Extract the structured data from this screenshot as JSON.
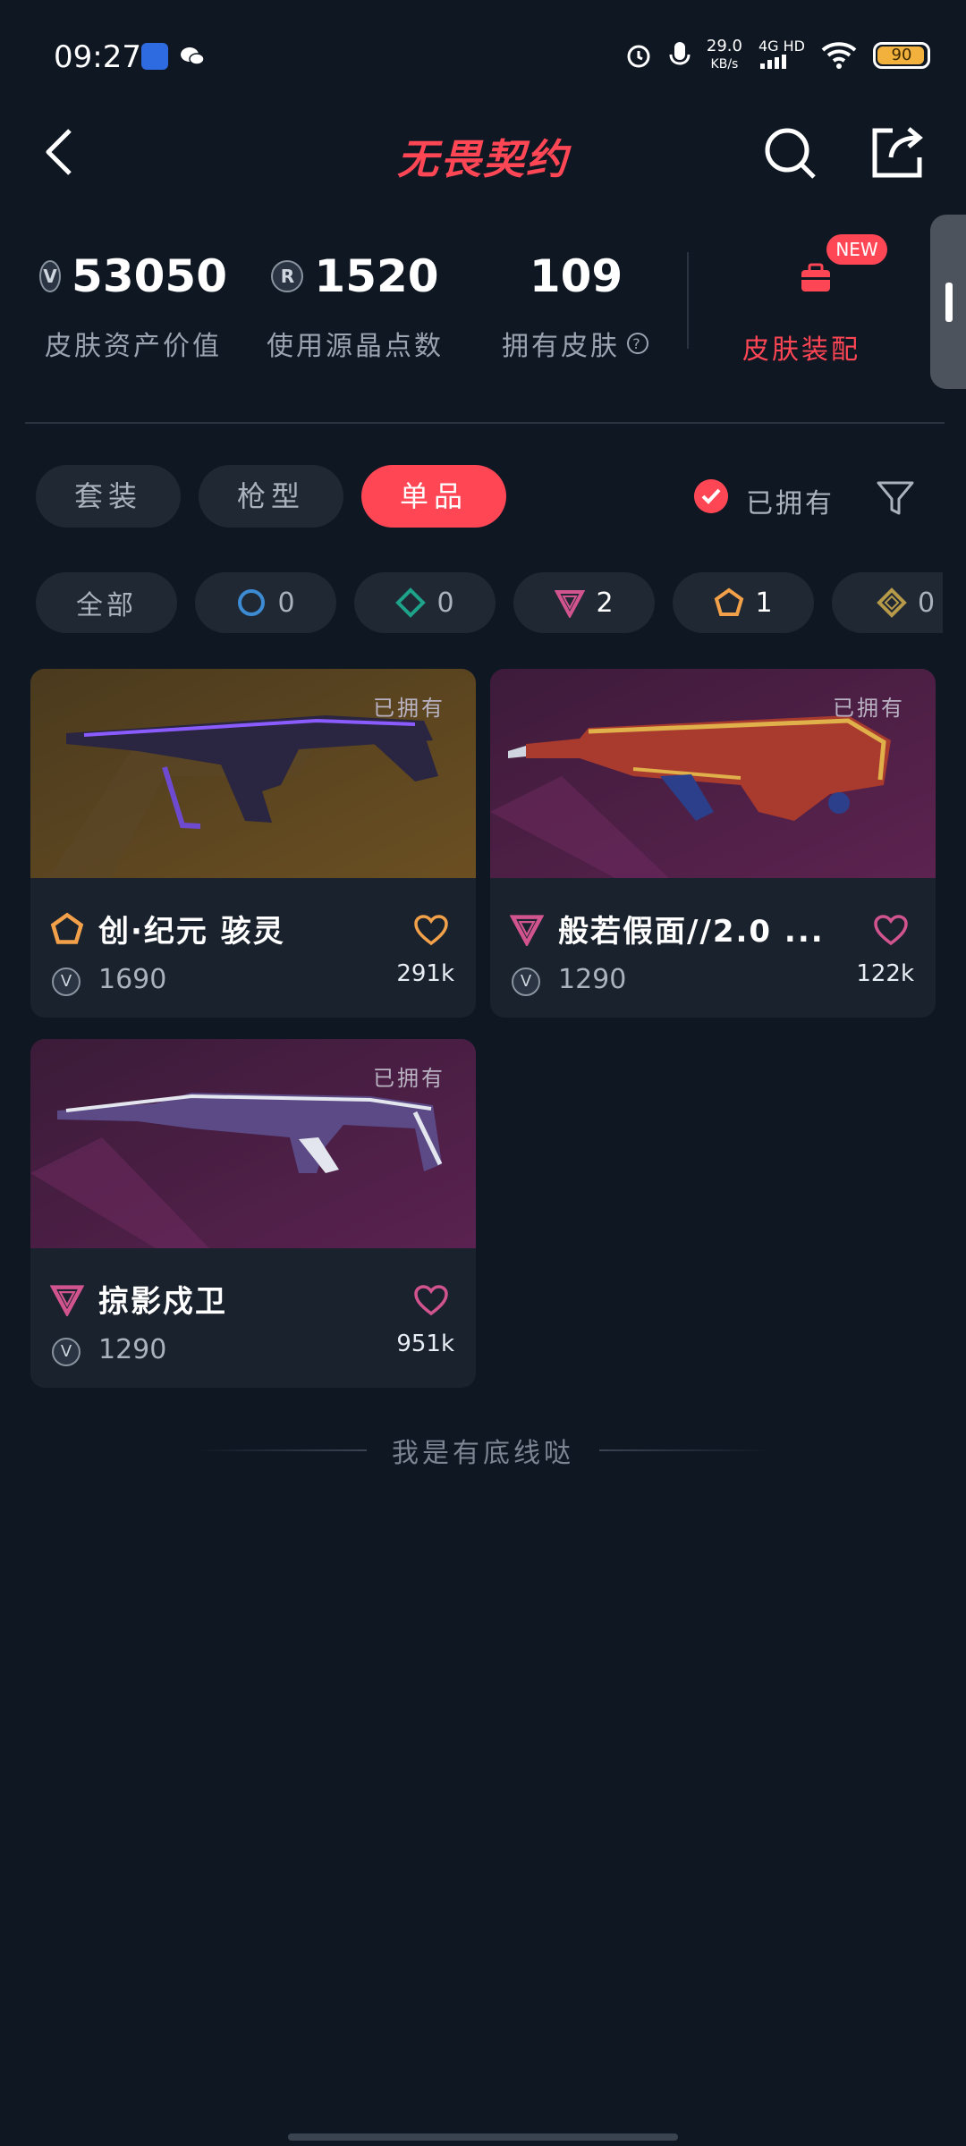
{
  "status_bar": {
    "time": "09:27",
    "net_speed": "29.0",
    "net_unit": "KB/s",
    "net_type": "4G HD",
    "battery": "90"
  },
  "header": {
    "title": "无畏契约"
  },
  "stats": {
    "asset_value": "53050",
    "asset_value_label": "皮肤资产价值",
    "radianite_points": "1520",
    "radianite_points_label": "使用源晶点数",
    "owned_skins": "109",
    "owned_skins_label": "拥有皮肤",
    "new_badge": "NEW",
    "assemble_label": "皮肤装配"
  },
  "tabs": [
    {
      "label": "套装"
    },
    {
      "label": "枪型"
    },
    {
      "label": "单品"
    }
  ],
  "owned_filter": {
    "label": "已拥有",
    "checked": true
  },
  "rarity_chips": [
    {
      "label": "全部"
    },
    {
      "count": "0",
      "icon": "select-tier-icon",
      "color": "#3d8bd3"
    },
    {
      "count": "0",
      "icon": "deluxe-tier-icon",
      "color": "#1ea38a"
    },
    {
      "count": "2",
      "icon": "premium-tier-icon",
      "color": "#d1548f"
    },
    {
      "count": "1",
      "icon": "exclusive-tier-icon",
      "color": "#f2a14a"
    },
    {
      "count": "0",
      "icon": "ultra-tier-icon",
      "color": "#b69a4a"
    }
  ],
  "skins": [
    {
      "name": "创·纪元 骇灵",
      "price": "1690",
      "likes": "291k",
      "owned_tag": "已拥有",
      "rarity_color": "#f2a14a",
      "heart_color": "#f2a14a"
    },
    {
      "name": "般若假面//2.0 ...",
      "price": "1290",
      "likes": "122k",
      "owned_tag": "已拥有",
      "rarity_color": "#d1548f",
      "heart_color": "#d1548f"
    },
    {
      "name": "掠影戍卫",
      "price": "1290",
      "likes": "951k",
      "owned_tag": "已拥有",
      "rarity_color": "#d1548f",
      "heart_color": "#d1548f"
    }
  ],
  "footer": {
    "end_text": "我是有底线哒"
  },
  "colors": {
    "accent": "#ff4655",
    "background": "#0f1723",
    "card": "#1a222d"
  }
}
